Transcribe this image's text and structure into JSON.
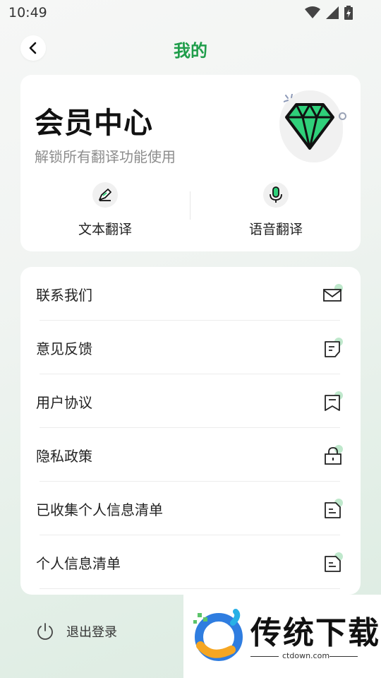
{
  "status_bar": {
    "time": "10:49"
  },
  "header": {
    "title": "我的"
  },
  "member": {
    "title": "会员中心",
    "subtitle": "解锁所有翻译功能使用",
    "features": [
      {
        "label": "文本翻译",
        "icon": "pen-icon"
      },
      {
        "label": "语音翻译",
        "icon": "microphone-icon"
      }
    ]
  },
  "menu": [
    {
      "label": "联系我们",
      "icon": "mail-icon"
    },
    {
      "label": "意见反馈",
      "icon": "note-icon"
    },
    {
      "label": "用户协议",
      "icon": "bookmark-icon"
    },
    {
      "label": "隐私政策",
      "icon": "lock-icon"
    },
    {
      "label": "已收集个人信息清单",
      "icon": "document-icon"
    },
    {
      "label": "个人信息清单",
      "icon": "document-icon"
    }
  ],
  "logout": {
    "label": "退出登录"
  },
  "watermark": {
    "text": "传统下载",
    "url": "ctdown.com"
  },
  "colors": {
    "accent": "#1f9d4a",
    "diamond": "#2fd07a"
  }
}
